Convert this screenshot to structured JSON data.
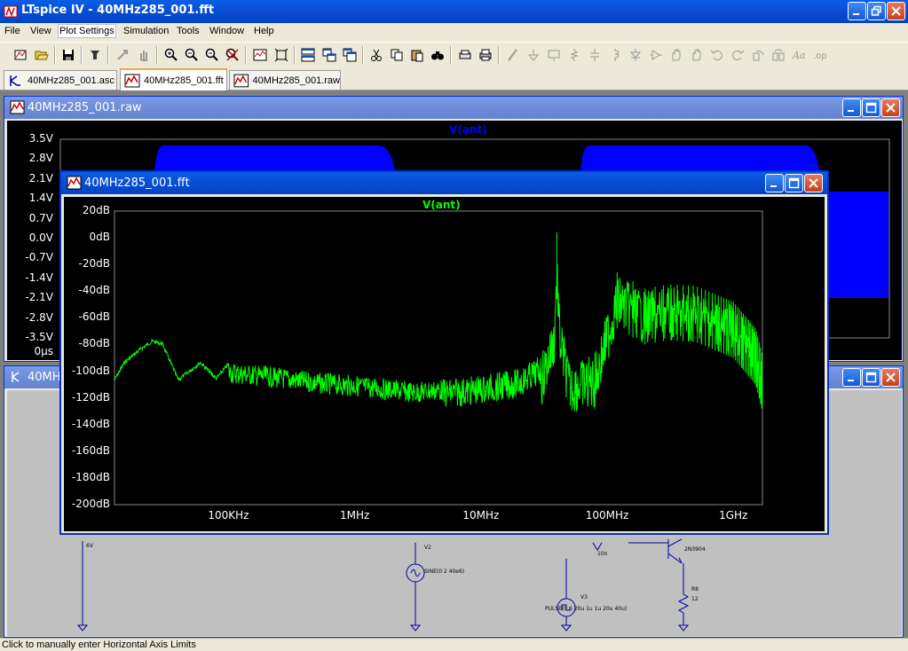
{
  "app": {
    "title": "LTspice IV - 40MHz285_001.fft"
  },
  "menu": [
    "File",
    "View",
    "Plot Settings",
    "Simulation",
    "Tools",
    "Window",
    "Help"
  ],
  "toolbar_icons": [
    "new-schematic-icon",
    "open-icon",
    "save-icon",
    "control-panel-icon",
    "run-icon",
    "halt-icon",
    "zoom-in-icon",
    "zoom-out-icon",
    "zoom-fit-icon",
    "zoom-cancel-icon",
    "autorange-icon",
    "zoom-extents-icon",
    "tile-horizontal-icon",
    "cascade-icon",
    "arrange-icon",
    "cut-icon",
    "copy-icon",
    "paste-icon",
    "find-icon",
    "print-setup-icon",
    "print-icon",
    "wire-icon",
    "ground-icon",
    "label-icon",
    "resistor-icon",
    "capacitor-icon",
    "inductor-icon",
    "diode-icon",
    "component-icon",
    "move-icon",
    "drag-icon",
    "undo-icon",
    "redo-icon",
    "rotate-icon",
    "mirror-icon",
    "text-icon",
    "spice-directive-icon"
  ],
  "tabs": [
    {
      "label": "40MHz285_001.asc",
      "icon": "schematic-icon",
      "active": false
    },
    {
      "label": "40MHz285_001.fft",
      "icon": "waveform-icon",
      "active": true
    },
    {
      "label": "40MHz285_001.raw",
      "icon": "waveform-icon",
      "active": false
    }
  ],
  "raw_window": {
    "title": "40MHz285_001.raw",
    "trace": "V(ant)",
    "trace_color": "#0000ff",
    "y_ticks": [
      "3.5V",
      "2.8V",
      "2.1V",
      "1.4V",
      "0.7V",
      "0.0V",
      "-0.7V",
      "-1.4V",
      "-2.1V",
      "-2.8V",
      "-3.5V"
    ],
    "x_first_tick": "0µs"
  },
  "schematic_window": {
    "title": "40MHz285_001.asc",
    "labels": {
      "v_supply": "6V",
      "v2_name": "V2",
      "v2_value": "SINE(0 2 40e6)",
      "v3_name": "V3",
      "v3_value": "PULSE(0 6 20u 1u 1u 20u 40u)",
      "inductor_value": "10n",
      "transistor": "2N3904",
      "r_name": "R8",
      "r_value": "12"
    }
  },
  "fft_window": {
    "title": "40MHz285_001.fft",
    "trace": "V(ant)",
    "trace_color": "#00ff00",
    "y_ticks": [
      "20dB",
      "0dB",
      "-20dB",
      "-40dB",
      "-60dB",
      "-80dB",
      "-100dB",
      "-120dB",
      "-140dB",
      "-160dB",
      "-180dB",
      "-200dB"
    ],
    "x_ticks": [
      "100KHz",
      "1MHz",
      "10MHz",
      "100MHz",
      "1GHz"
    ]
  },
  "chart_data": {
    "type": "line",
    "x_scale": "log",
    "xlabel": "",
    "ylabel": "",
    "ylim_dB": [
      -200,
      20
    ],
    "xlim_Hz": [
      12500,
      1700000000
    ],
    "series": [
      {
        "name": "V(ant)",
        "description": "FFT magnitude, green trace",
        "envelope_points_Hz_dB": [
          [
            12500,
            -105
          ],
          [
            15000,
            -92
          ],
          [
            20000,
            -82
          ],
          [
            25000,
            -76
          ],
          [
            30000,
            -78
          ],
          [
            40000,
            -105
          ],
          [
            60000,
            -92
          ],
          [
            80000,
            -104
          ],
          [
            100000,
            -93
          ],
          [
            200000,
            -96
          ],
          [
            500000,
            -101
          ],
          [
            1000000,
            -103
          ],
          [
            3000000,
            -108
          ],
          [
            10000000,
            -103
          ],
          [
            20000000,
            -98
          ],
          [
            30000000,
            -88
          ],
          [
            38000000,
            -58
          ],
          [
            40000000,
            -5
          ],
          [
            42000000,
            -55
          ],
          [
            50000000,
            -92
          ],
          [
            80000000,
            -88
          ],
          [
            120000000,
            -28
          ],
          [
            200000000,
            -40
          ],
          [
            300000000,
            -37
          ],
          [
            500000000,
            -38
          ],
          [
            1000000000,
            -50
          ],
          [
            1500000000,
            -70
          ],
          [
            1700000000,
            -90
          ]
        ],
        "peak": {
          "frequency_Hz": 40000000,
          "level_dB": 4
        }
      }
    ],
    "grid": false
  },
  "status": "Click to manually enter Horizontal Axis Limits"
}
